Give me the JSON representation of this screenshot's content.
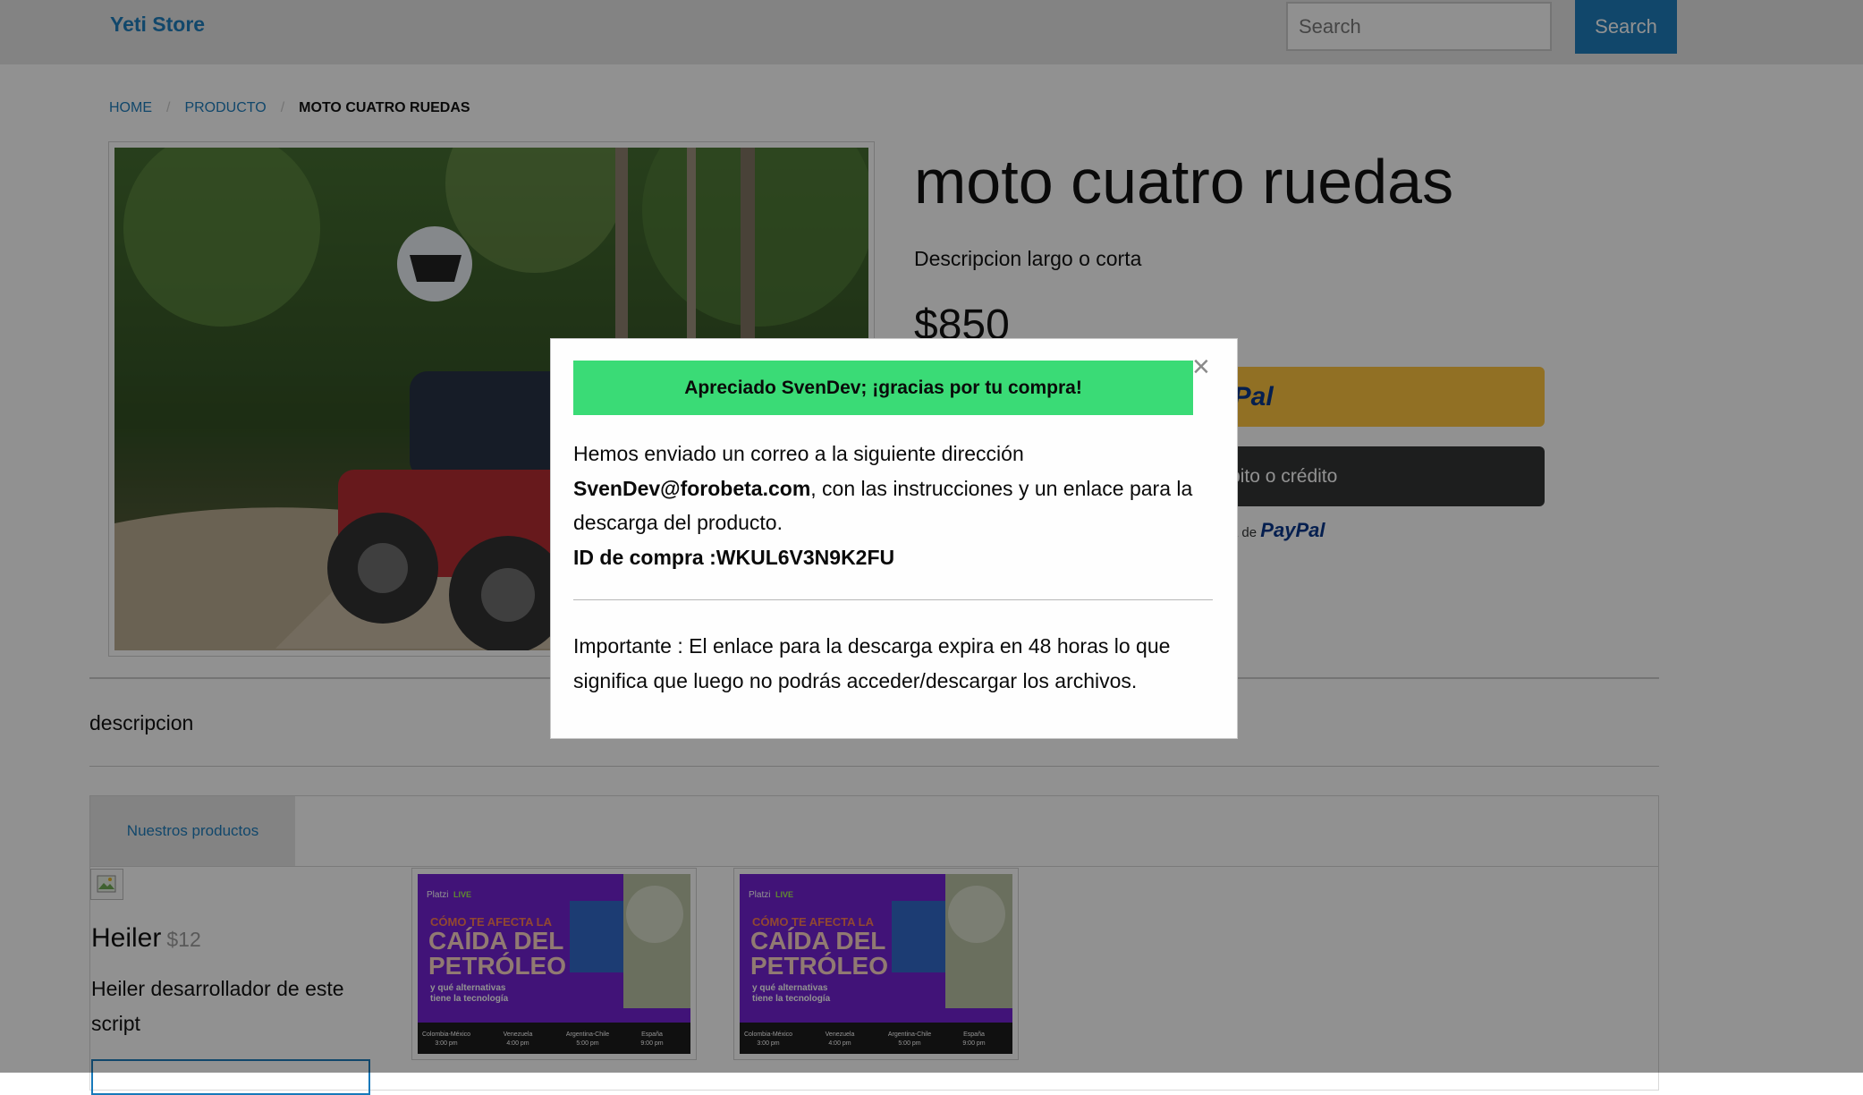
{
  "header": {
    "brand": "Yeti Store",
    "search": {
      "placeholder": "Search",
      "button_label": "Search"
    }
  },
  "breadcrumb": [
    "Home",
    "Producto",
    "moto cuatro ruedas"
  ],
  "product": {
    "title": "moto cuatro ruedas",
    "short_description": "Descripcion largo o corta",
    "price": "$850",
    "paypal_button_logo": "PayPal",
    "card_button_label": "Tarjeta de débito o crédito",
    "powered_by_prefix": "Con la tecnología de",
    "powered_by_brand": "PayPal",
    "description": "descripcion"
  },
  "tabs": [
    {
      "label": "Nuestros productos"
    }
  ],
  "related_products": [
    {
      "name": "Heiler",
      "price": "$12",
      "description": "Heiler desarrollador de este script"
    }
  ],
  "promo_thumbnails": [
    {
      "brand": "Platzi",
      "badge": "LIVE",
      "kicker": "CÓMO TE AFECTA LA",
      "headline_1": "CAÍDA DEL",
      "headline_2": "PETRÓLEO",
      "sub_1": "y qué alternativas",
      "sub_2": "tiene la tecnología",
      "schedule": [
        {
          "place": "Colombia-México",
          "time": "3:00 pm"
        },
        {
          "place": "Venezuela",
          "time": "4:00 pm"
        },
        {
          "place": "Argentina-Chile",
          "time": "5:00 pm"
        },
        {
          "place": "España",
          "time": "9:00 pm"
        }
      ]
    },
    {
      "brand": "Platzi",
      "badge": "LIVE",
      "kicker": "CÓMO TE AFECTA LA",
      "headline_1": "CAÍDA DEL",
      "headline_2": "PETRÓLEO",
      "sub_1": "y qué alternativas",
      "sub_2": "tiene la tecnología",
      "schedule": [
        {
          "place": "Colombia-México",
          "time": "3:00 pm"
        },
        {
          "place": "Venezuela",
          "time": "4:00 pm"
        },
        {
          "place": "Argentina-Chile",
          "time": "5:00 pm"
        },
        {
          "place": "España",
          "time": "9:00 pm"
        }
      ]
    }
  ],
  "modal": {
    "close_symbol": "×",
    "success_message": "Apreciado SvenDev; ¡gracias por tu compra!",
    "body_intro": "Hemos enviado un correo a la siguiente dirección",
    "email": "SvenDev@forobeta.com",
    "body_after_email": ", con las instrucciones y un enlace para la descarga del producto.",
    "purchase_id_label": "ID de compra :",
    "purchase_id": "WKUL6V3N9K2FU",
    "note": "Importante : El enlace para la descarga expira en 48 horas lo que significa que luego no podrás acceder/descargar los archivos."
  },
  "colors": {
    "primary": "#1779ba",
    "success": "#3adb76",
    "paypal_yellow": "#ffc439",
    "dark_button": "#2c2e2f",
    "overlay": "rgba(10,10,10,0.45)"
  },
  "icons": {
    "close": "close-icon",
    "broken_image": "broken-image-icon"
  }
}
